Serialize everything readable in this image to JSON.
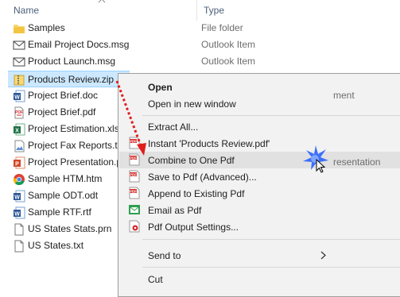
{
  "header": {
    "name_col": "Name",
    "type_col": "Type"
  },
  "files": [
    {
      "name": "Samples",
      "type": "File folder",
      "icon": "folder-icon"
    },
    {
      "name": "Email Project Docs.msg",
      "type": "Outlook Item",
      "icon": "mail-icon"
    },
    {
      "name": "Product Launch.msg",
      "type": "Outlook Item",
      "icon": "mail-icon"
    },
    {
      "name": "Products Review.zip",
      "type": "",
      "icon": "zip-icon"
    },
    {
      "name": "Project Brief.doc",
      "type": "",
      "icon": "word-icon"
    },
    {
      "name": "Project Brief.pdf",
      "type": "",
      "icon": "pdf-icon"
    },
    {
      "name": "Project Estimation.xlsx",
      "type": "",
      "icon": "excel-icon"
    },
    {
      "name": "Project Fax Reports.tif",
      "type": "",
      "icon": "image-icon"
    },
    {
      "name": "Project Presentation.p",
      "type": "",
      "icon": "powerpoint-icon"
    },
    {
      "name": "Sample HTM.htm",
      "type": "",
      "icon": "chrome-icon"
    },
    {
      "name": "Sample ODT.odt",
      "type": "",
      "icon": "word-icon"
    },
    {
      "name": "Sample RTF.rtf",
      "type": "",
      "icon": "word-icon"
    },
    {
      "name": "US States Stats.prn",
      "type": "",
      "icon": "text-file-icon"
    },
    {
      "name": "US States.txt",
      "type": "",
      "icon": "text-file-icon"
    }
  ],
  "partial_types": {
    "word": "ment",
    "presentation": "resentation"
  },
  "context_menu": {
    "open": "Open",
    "open_new_window": "Open in new window",
    "extract_all": "Extract All...",
    "instant": "Instant 'Products Review.pdf'",
    "combine": "Combine to One Pdf",
    "save_advanced": "Save to Pdf (Advanced)...",
    "append": "Append to Existing Pdf",
    "email_pdf": "Email as Pdf",
    "output_settings": "Pdf Output Settings...",
    "send_to": "Send to",
    "cut": "Cut"
  },
  "colors": {
    "selection": "#cce8ff",
    "menu_bg": "#f2f2f2",
    "highlight": "#e1e1e1",
    "pdf_red": "#d62b2b",
    "arrow_red": "#e01e1e",
    "spark_blue": "#1e5bff"
  }
}
